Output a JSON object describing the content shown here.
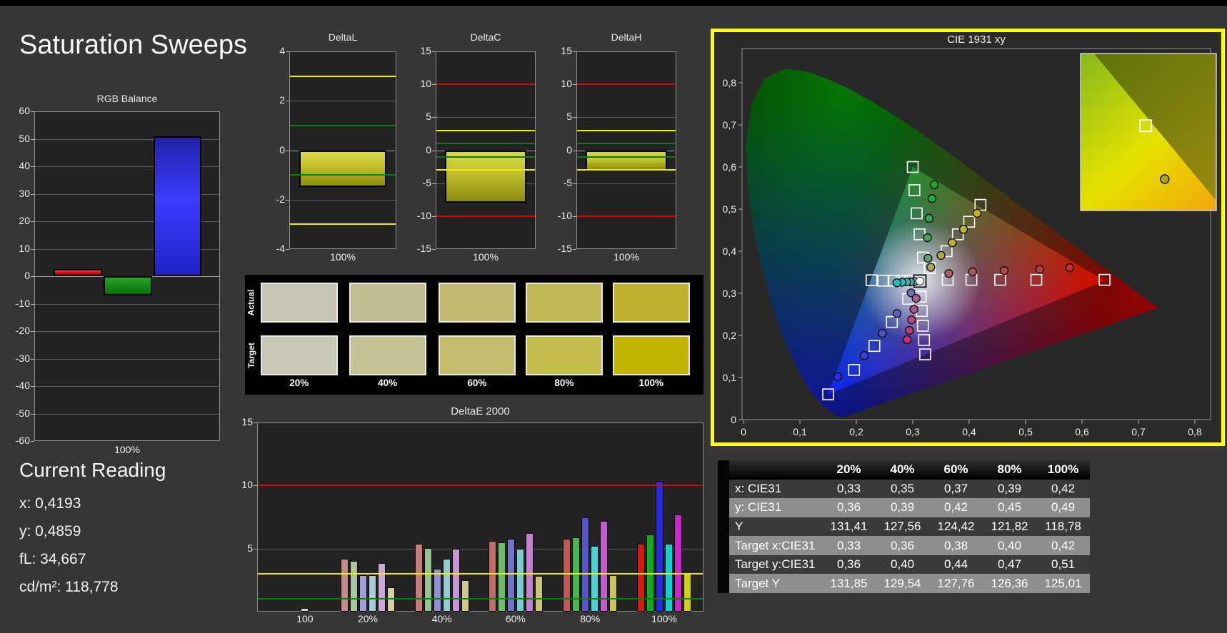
{
  "title": "Saturation Sweeps",
  "current_reading": {
    "title": "Current Reading",
    "lines": [
      "x: 0,4193",
      "y: 0,4859",
      "fL: 34,667",
      "cd/m²: 118,778"
    ]
  },
  "colors": {
    "background": "#363636",
    "panel_bg": "#2b2b2b",
    "plot_bg": "#232323",
    "cie_border": "#ffff00",
    "limit_red": "#e00000",
    "limit_yellow": "#f0f000",
    "limit_green": "#0c7c0c"
  },
  "chart_data": [
    {
      "id": "rgb_balance",
      "type": "bar",
      "title": "RGB Balance",
      "xlabel": "100%",
      "ylim": [
        -60,
        60
      ],
      "yticks": [
        60,
        50,
        40,
        30,
        20,
        10,
        0,
        -10,
        -20,
        -30,
        -40,
        -50,
        -60
      ],
      "gridlines": [
        50,
        40,
        30,
        20,
        10,
        0,
        -10,
        -20,
        -30,
        -40,
        -50
      ],
      "categories": [
        "red",
        "green",
        "blue"
      ],
      "values": [
        2.5,
        -7,
        51
      ]
    },
    {
      "id": "delta_l",
      "type": "bar",
      "title": "DeltaL",
      "xlabel": "100%",
      "ylim": [
        -4,
        4
      ],
      "yticks": [
        4,
        2,
        0,
        -2,
        -4
      ],
      "gridlines": [
        2,
        0,
        -2
      ],
      "limit_lines": [
        {
          "value": 3,
          "color": "#f0f000"
        },
        {
          "value": -3,
          "color": "#f0f000"
        },
        {
          "value": 1,
          "color": "#0c7c0c"
        },
        {
          "value": -1,
          "color": "#0c7c0c"
        }
      ],
      "categories": [
        "100%"
      ],
      "values": [
        -1.5
      ]
    },
    {
      "id": "delta_c",
      "type": "bar",
      "title": "DeltaC",
      "xlabel": "100%",
      "ylim": [
        -15,
        15
      ],
      "yticks": [
        15,
        10,
        5,
        0,
        -5,
        -10,
        -15
      ],
      "gridlines": [
        10,
        5,
        0,
        -5,
        -10
      ],
      "limit_lines": [
        {
          "value": 10,
          "color": "#e00000"
        },
        {
          "value": -10,
          "color": "#e00000"
        },
        {
          "value": 3,
          "color": "#f0f000"
        },
        {
          "value": -3,
          "color": "#f0f000"
        },
        {
          "value": 1,
          "color": "#0c7c0c"
        },
        {
          "value": -1,
          "color": "#0c7c0c"
        }
      ],
      "categories": [
        "100%"
      ],
      "values": [
        -8
      ]
    },
    {
      "id": "delta_h",
      "type": "bar",
      "title": "DeltaH",
      "xlabel": "100%",
      "ylim": [
        -15,
        15
      ],
      "yticks": [
        15,
        10,
        5,
        0,
        -5,
        -10,
        -15
      ],
      "gridlines": [
        10,
        5,
        0,
        -5,
        -10
      ],
      "limit_lines": [
        {
          "value": 10,
          "color": "#e00000"
        },
        {
          "value": -10,
          "color": "#e00000"
        },
        {
          "value": 3,
          "color": "#f0f000"
        },
        {
          "value": -3,
          "color": "#f0f000"
        },
        {
          "value": 1,
          "color": "#0c7c0c"
        },
        {
          "value": -1,
          "color": "#0c7c0c"
        }
      ],
      "categories": [
        "100%"
      ],
      "values": [
        -3.2
      ]
    },
    {
      "id": "delta_e_2000",
      "type": "bar",
      "title": "DeltaE 2000",
      "ylim": [
        0,
        15
      ],
      "yticks": [
        15,
        10,
        5
      ],
      "gridlines": [
        10,
        5
      ],
      "limit_lines": [
        {
          "value": 10,
          "color": "#e00000"
        },
        {
          "value": 3,
          "color": "#f0f000"
        },
        {
          "value": 1,
          "color": "#0c7c0c"
        }
      ],
      "groups": [
        {
          "label": "100",
          "center": 0.107,
          "values": [
            0.3
          ],
          "colors": [
            "#d7d7cb"
          ]
        },
        {
          "label": "20%",
          "center": 0.248,
          "values": [
            4.2,
            4.0,
            2.9,
            2.9,
            3.85,
            1.9
          ],
          "colors": [
            "#c38b8b",
            "#a9c59c",
            "#9f9fd6",
            "#a9cdd6",
            "#c9a9d4",
            "#d3cf9f"
          ]
        },
        {
          "label": "40%",
          "center": 0.414,
          "values": [
            5.4,
            5.05,
            3.4,
            4.2,
            5.0,
            2.5
          ],
          "colors": [
            "#c57c7c",
            "#93c48b",
            "#9090d2",
            "#8fcccc",
            "#c795d2",
            "#cfc98b"
          ]
        },
        {
          "label": "60%",
          "center": 0.579,
          "values": [
            5.6,
            5.5,
            5.75,
            5.0,
            6.25,
            2.85
          ],
          "colors": [
            "#c76a6a",
            "#6cbc68",
            "#7272d2",
            "#7fccd2",
            "#c77ed4",
            "#ccc476"
          ]
        },
        {
          "label": "80%",
          "center": 0.746,
          "values": [
            5.8,
            5.9,
            7.45,
            5.2,
            7.2,
            2.9
          ],
          "colors": [
            "#c75555",
            "#4cb352",
            "#5555d4",
            "#4fd0d4",
            "#c958d4",
            "#cdc25e"
          ]
        },
        {
          "label": "100%",
          "center": 0.912,
          "values": [
            5.4,
            6.1,
            10.35,
            5.35,
            7.7,
            3.0
          ],
          "colors": [
            "#df1414",
            "#16aa24",
            "#2828ee",
            "#12d0d0",
            "#d022d0",
            "#d2cf14"
          ]
        }
      ]
    },
    {
      "id": "cie_1931_xy",
      "type": "scatter",
      "title": "CIE 1931 xy",
      "xlim": [
        0,
        0.828
      ],
      "ylim": [
        0,
        0.881
      ],
      "xticks": [
        "0",
        "0,1",
        "0,2",
        "0,3",
        "0,4",
        "0,5",
        "0,6",
        "0,7",
        "0,8"
      ],
      "yticks": [
        "0",
        "0,1",
        "0,2",
        "0,3",
        "0,4",
        "0,5",
        "0,6",
        "0,7",
        "0,8"
      ],
      "gamut_triangle": [
        [
          0.64,
          0.33
        ],
        [
          0.3,
          0.6
        ],
        [
          0.15,
          0.06
        ]
      ],
      "white_point": [
        0.3127,
        0.329
      ],
      "spectral_locus": [
        [
          0.1741,
          0.005
        ],
        [
          0.166,
          0.009
        ],
        [
          0.1566,
          0.0177
        ],
        [
          0.144,
          0.0297
        ],
        [
          0.1241,
          0.0578
        ],
        [
          0.1096,
          0.0868
        ],
        [
          0.0913,
          0.1327
        ],
        [
          0.0687,
          0.2007
        ],
        [
          0.0454,
          0.295
        ],
        [
          0.0235,
          0.4127
        ],
        [
          0.0082,
          0.5384
        ],
        [
          0.0039,
          0.6548
        ],
        [
          0.0139,
          0.7502
        ],
        [
          0.0389,
          0.812
        ],
        [
          0.0743,
          0.8338
        ],
        [
          0.1142,
          0.8262
        ],
        [
          0.1547,
          0.8059
        ],
        [
          0.1929,
          0.7816
        ],
        [
          0.2296,
          0.7543
        ],
        [
          0.2658,
          0.7243
        ],
        [
          0.3016,
          0.6923
        ],
        [
          0.3373,
          0.6589
        ],
        [
          0.3731,
          0.6245
        ],
        [
          0.4087,
          0.5896
        ],
        [
          0.4441,
          0.5547
        ],
        [
          0.4788,
          0.5202
        ],
        [
          0.5125,
          0.4866
        ],
        [
          0.5448,
          0.4544
        ],
        [
          0.5752,
          0.4242
        ],
        [
          0.6029,
          0.3965
        ],
        [
          0.627,
          0.3725
        ],
        [
          0.6482,
          0.3514
        ],
        [
          0.6658,
          0.334
        ],
        [
          0.6801,
          0.3197
        ],
        [
          0.6915,
          0.3083
        ],
        [
          0.7006,
          0.2993
        ],
        [
          0.7079,
          0.292
        ],
        [
          0.719,
          0.2809
        ],
        [
          0.726,
          0.274
        ],
        [
          0.7347,
          0.2653
        ]
      ],
      "sweeps": [
        {
          "name": "green",
          "targets": [
            [
              0.318,
              0.385
            ],
            [
              0.312,
              0.44
            ],
            [
              0.307,
              0.49
            ],
            [
              0.303,
              0.545
            ],
            [
              0.3,
              0.6
            ]
          ],
          "measures": [
            [
              0.327,
              0.383
            ],
            [
              0.326,
              0.432
            ],
            [
              0.329,
              0.478
            ],
            [
              0.334,
              0.525
            ],
            [
              0.338,
              0.558
            ]
          ],
          "fills": [
            "#5aa56a",
            "#46a75a",
            "#33a94b",
            "#21ab3c",
            "#12ad2f"
          ]
        },
        {
          "name": "yellow",
          "targets": [
            [
              0.33,
              0.36
            ],
            [
              0.36,
              0.4
            ],
            [
              0.38,
              0.44
            ],
            [
              0.4,
              0.47
            ],
            [
              0.42,
              0.51
            ]
          ],
          "measures": [
            [
              0.332,
              0.362
            ],
            [
              0.35,
              0.39
            ],
            [
              0.37,
              0.42
            ],
            [
              0.39,
              0.452
            ],
            [
              0.414,
              0.49
            ]
          ],
          "fills": [
            "#a8a75c",
            "#b0ac4c",
            "#b8b13c",
            "#beb52c",
            "#c4b81a"
          ]
        },
        {
          "name": "red",
          "targets": [
            [
              0.362,
              0.332
            ],
            [
              0.404,
              0.332
            ],
            [
              0.455,
              0.332
            ],
            [
              0.519,
              0.332
            ],
            [
              0.64,
              0.332
            ]
          ],
          "measures": [
            [
              0.364,
              0.347
            ],
            [
              0.406,
              0.351
            ],
            [
              0.462,
              0.354
            ],
            [
              0.525,
              0.357
            ],
            [
              0.578,
              0.361
            ]
          ],
          "fills": [
            "#a86060",
            "#b05454",
            "#b84747",
            "#c03a3a",
            "#c62e2e"
          ]
        },
        {
          "name": "blue",
          "targets": [
            [
              0.292,
              0.287
            ],
            [
              0.263,
              0.232
            ],
            [
              0.232,
              0.175
            ],
            [
              0.196,
              0.118
            ],
            [
              0.15,
              0.06
            ]
          ],
          "measures": [
            [
              0.297,
              0.301
            ],
            [
              0.272,
              0.252
            ],
            [
              0.246,
              0.205
            ],
            [
              0.214,
              0.152
            ],
            [
              0.167,
              0.102
            ]
          ],
          "fills": [
            "#7070b0",
            "#6060bc",
            "#5050c8",
            "#3e3ed6",
            "#2c2ce4"
          ]
        },
        {
          "name": "magenta",
          "targets": [
            [
              0.314,
              0.292
            ],
            [
              0.316,
              0.258
            ],
            [
              0.318,
              0.223
            ],
            [
              0.32,
              0.189
            ],
            [
              0.322,
              0.155
            ]
          ],
          "measures": [
            [
              0.306,
              0.288
            ],
            [
              0.302,
              0.262
            ],
            [
              0.298,
              0.237
            ],
            [
              0.294,
              0.212
            ],
            [
              0.29,
              0.19
            ]
          ],
          "fills": [
            "#a86292",
            "#b05589",
            "#b84880",
            "#c03b77",
            "#c62e6e"
          ]
        },
        {
          "name": "cyan",
          "targets": [
            [
              0.296,
              0.33
            ],
            [
              0.281,
              0.33
            ],
            [
              0.266,
              0.33
            ],
            [
              0.248,
              0.33
            ],
            [
              0.227,
              0.331
            ]
          ],
          "measures": [
            [
              0.303,
              0.328
            ],
            [
              0.296,
              0.327
            ],
            [
              0.289,
              0.327
            ],
            [
              0.281,
              0.326
            ],
            [
              0.272,
              0.325
            ]
          ],
          "fills": [
            "#5fa8a8",
            "#50aeae",
            "#40b4b4",
            "#30baba",
            "#20c0c0"
          ]
        }
      ],
      "inset": {
        "square": [
          0.48,
          0.46
        ],
        "dot": [
          0.62,
          0.8
        ]
      }
    }
  ],
  "swatches": {
    "row_labels": [
      "Actual",
      "Target"
    ],
    "col_labels": [
      "20%",
      "40%",
      "60%",
      "80%",
      "100%"
    ],
    "actual_colors": [
      "#c7c4b3",
      "#c3be92",
      "#c3ba71",
      "#c2b955",
      "#c0b02e"
    ],
    "target_colors": [
      "#c8c6b5",
      "#c6c192",
      "#c4bd6e",
      "#c2bd4a",
      "#c2b400"
    ]
  },
  "table": {
    "corner": "",
    "headers": [
      "20%",
      "40%",
      "60%",
      "80%",
      "100%"
    ],
    "rows": [
      {
        "label": "x: CIE31",
        "values": [
          "0,33",
          "0,35",
          "0,37",
          "0,39",
          "0,42"
        ]
      },
      {
        "label": "y: CIE31",
        "values": [
          "0,36",
          "0,39",
          "0,42",
          "0,45",
          "0,49"
        ]
      },
      {
        "label": "Y",
        "values": [
          "131,41",
          "127,56",
          "124,42",
          "121,82",
          "118,78"
        ]
      },
      {
        "label": "Target x:CIE31",
        "values": [
          "0,33",
          "0,36",
          "0,38",
          "0,40",
          "0,42"
        ]
      },
      {
        "label": "Target y:CIE31",
        "values": [
          "0,36",
          "0,40",
          "0,44",
          "0,47",
          "0,51"
        ]
      },
      {
        "label": "Target Y",
        "values": [
          "131,85",
          "129,54",
          "127,76",
          "126,36",
          "125,01"
        ]
      }
    ]
  }
}
